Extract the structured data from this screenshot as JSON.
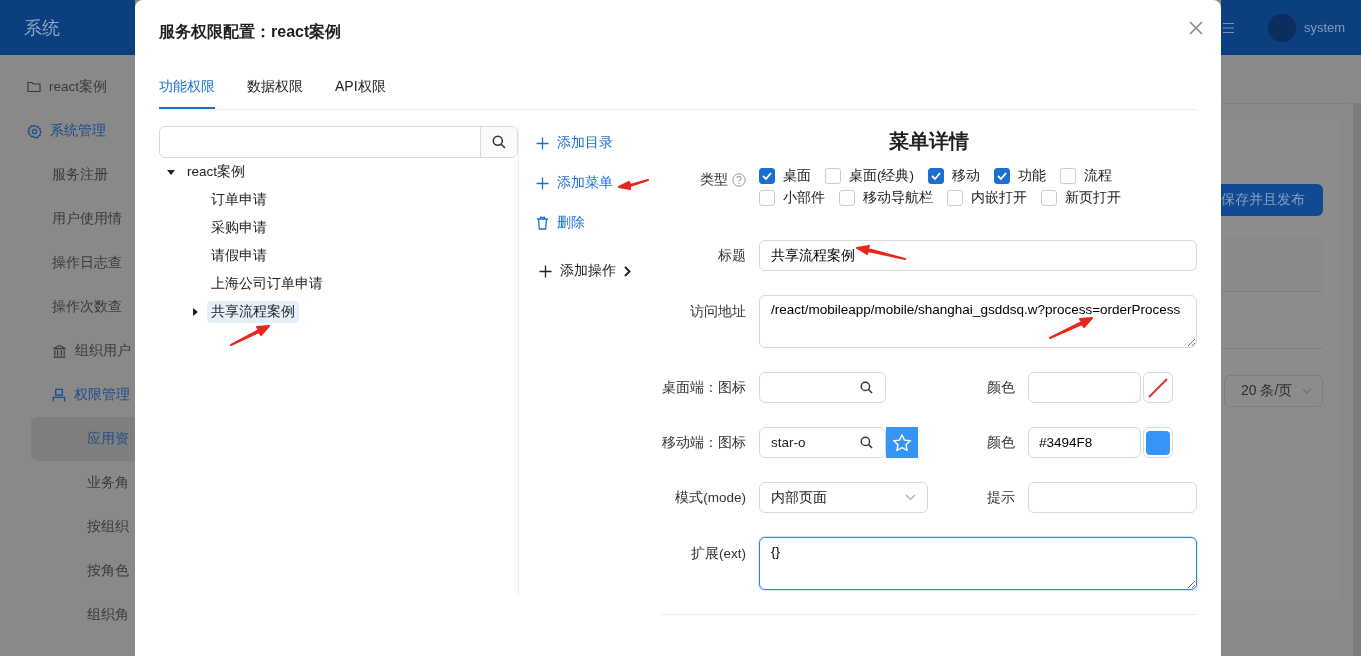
{
  "app_header": {
    "title": "系统",
    "user": "system"
  },
  "sidebar": {
    "items": [
      {
        "label": "react案例",
        "kind": "folder",
        "expanded": false,
        "selected": false
      },
      {
        "label": "系统管理",
        "kind": "gear",
        "expanded": true,
        "selected": false,
        "children": [
          {
            "label": "服务注册",
            "selected": false
          },
          {
            "label": "用户使用情",
            "selected": false
          },
          {
            "label": "操作日志查",
            "selected": false
          },
          {
            "label": "操作次数查",
            "selected": false
          },
          {
            "label": "组织用户",
            "kind": "bank",
            "expanded": false,
            "selected": false
          },
          {
            "label": "权限管理",
            "kind": "person",
            "expanded": true,
            "selected": false,
            "children": [
              {
                "label": "应用资",
                "selected": true
              },
              {
                "label": "业务角",
                "selected": false
              },
              {
                "label": "按组织",
                "selected": false
              },
              {
                "label": "按角色",
                "selected": false
              },
              {
                "label": "组织角",
                "selected": false
              }
            ]
          }
        ]
      }
    ]
  },
  "background_page": {
    "publish_button": "保存并且发布",
    "page_size": "20 条/页"
  },
  "modal": {
    "title": "服务权限配置：react案例",
    "tabs": [
      {
        "label": "功能权限",
        "selected": true
      },
      {
        "label": "数据权限",
        "selected": false
      },
      {
        "label": "API权限",
        "selected": false
      }
    ],
    "tree": {
      "nodes": [
        {
          "label": "react案例",
          "kind": "branch",
          "expanded": true,
          "selected": false,
          "children": [
            {
              "label": "订单申请",
              "kind": "leaf",
              "selected": false
            },
            {
              "label": "采购申请",
              "kind": "leaf",
              "selected": false
            },
            {
              "label": "请假申请",
              "kind": "leaf",
              "selected": false
            },
            {
              "label": "上海公司订单申请",
              "kind": "leaf",
              "selected": false
            },
            {
              "label": "共享流程案例",
              "kind": "branch",
              "expanded": false,
              "selected": true
            }
          ]
        }
      ]
    },
    "actions": [
      {
        "label": "添加目录",
        "kind": "add"
      },
      {
        "label": "添加菜单",
        "kind": "add"
      },
      {
        "label": "删除",
        "kind": "delete"
      },
      {
        "label": "添加操作",
        "kind": "operation"
      }
    ],
    "form": {
      "heading": "菜单详情",
      "type": {
        "label": "类型",
        "options": [
          {
            "label": "桌面",
            "checked": true
          },
          {
            "label": "桌面(经典)",
            "checked": false
          },
          {
            "label": "移动",
            "checked": true
          },
          {
            "label": "功能",
            "checked": true
          },
          {
            "label": "流程",
            "checked": false
          },
          {
            "label": "小部件",
            "checked": false
          },
          {
            "label": "移动导航栏",
            "checked": false
          },
          {
            "label": "内嵌打开",
            "checked": false
          },
          {
            "label": "新页打开",
            "checked": false
          }
        ]
      },
      "fields": [
        {
          "kind": "text",
          "label": "标题",
          "value": "共享流程案例"
        },
        {
          "kind": "textarea",
          "label": "访问地址",
          "value": "/react/mobileapp/mobile/shanghai_gsddsq.w?process=orderProcess",
          "focused": false
        },
        {
          "kind": "icon_color",
          "label": "桌面端：图标",
          "color_label": "颜色"
        },
        {
          "kind": "icon_color",
          "label": "移动端：图标",
          "value": "star-o",
          "color_label": "颜色",
          "color_value": "#3494F8"
        },
        {
          "kind": "select_text",
          "label": "模式(mode)",
          "value": "内部页面",
          "right_label": "提示"
        },
        {
          "kind": "textarea",
          "label": "扩展(ext)",
          "value": "{}",
          "focused": true
        }
      ]
    }
  }
}
